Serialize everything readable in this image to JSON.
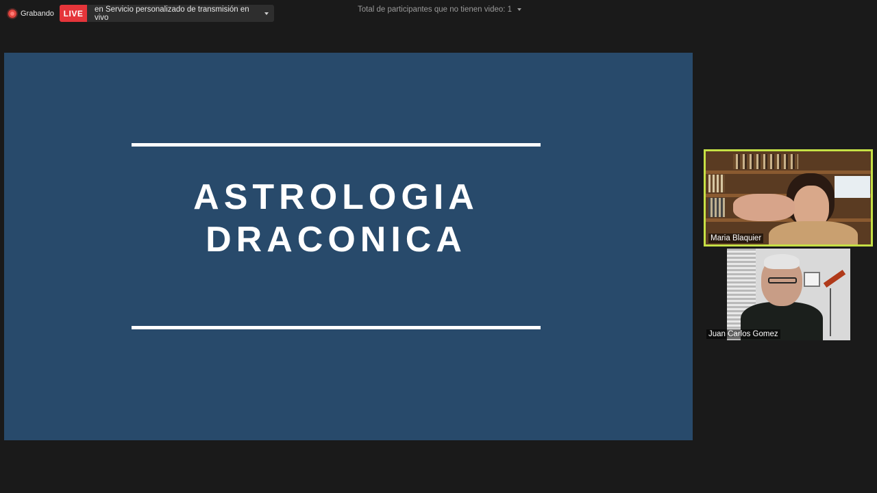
{
  "topbar": {
    "recording_label": "Grabando",
    "live_badge": "LIVE",
    "stream_target": "en Servicio personalizado de transmisión en vivo",
    "no_video_count": "Total de participantes que no tienen video: 1"
  },
  "slide": {
    "title_line1": "ASTROLOGIA",
    "title_line2": "DRACONICA"
  },
  "participants": [
    {
      "name": "Maria Blaquier",
      "active_speaker": true
    },
    {
      "name": "Juan Carlos Gomez",
      "active_speaker": false
    }
  ],
  "colors": {
    "slide_background": "#284a6b",
    "active_speaker_border": "#c6e045",
    "live_badge": "#e5353a",
    "app_background": "#1a1a1a"
  }
}
